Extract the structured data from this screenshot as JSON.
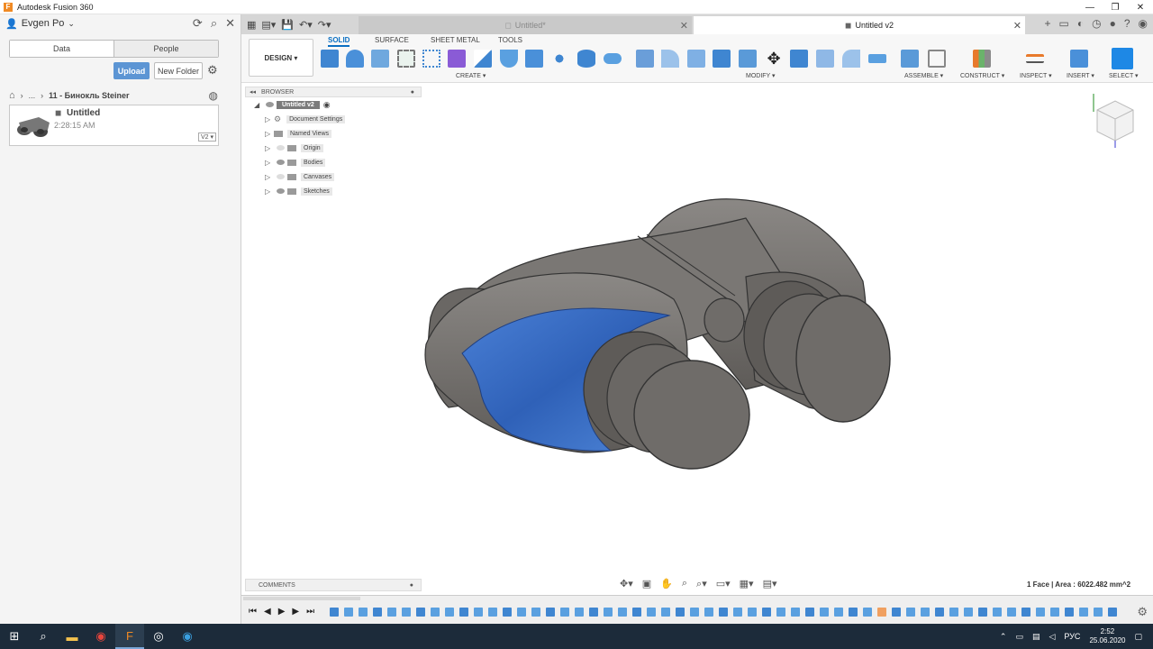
{
  "window": {
    "title": "Autodesk Fusion 360"
  },
  "data_panel": {
    "user": "Evgen Po",
    "tabs": [
      "Data",
      "People"
    ],
    "upload_label": "Upload",
    "new_folder_label": "New Folder",
    "breadcrumb": {
      "ellipsis": "...",
      "current": "11 - Бинокль Steiner"
    },
    "file": {
      "name": "Untitled",
      "time": "2:28:15 AM",
      "version": "V2 ▾"
    }
  },
  "doc_tabs": [
    {
      "label": "Untitled*",
      "active": false
    },
    {
      "label": "Untitled v2",
      "active": true
    }
  ],
  "toolbar": {
    "workspace_label": "DESIGN ▾",
    "tabs": [
      "SOLID",
      "SURFACE",
      "SHEET METAL",
      "TOOLS"
    ],
    "groups": {
      "create": "CREATE ▾",
      "modify": "MODIFY ▾",
      "assemble": "ASSEMBLE ▾",
      "construct": "CONSTRUCT ▾",
      "inspect": "INSPECT ▾",
      "insert": "INSERT ▾",
      "select": "SELECT ▾"
    }
  },
  "browser": {
    "title": "BROWSER",
    "root": "Untitled v2",
    "items": [
      "Document Settings",
      "Named Views",
      "Origin",
      "Bodies",
      "Canvases",
      "Sketches"
    ]
  },
  "comments_label": "COMMENTS",
  "status": {
    "selection": "1 Face | Area : 6022.482 mm^2"
  },
  "taskbar": {
    "lang": "РУС",
    "time": "2:52",
    "date": "25.06.2020"
  },
  "colors": {
    "accent": "#0a6fc2",
    "upload": "#5c95d4",
    "selected_face": "#3a6fc6",
    "body": "#6e6b67"
  }
}
